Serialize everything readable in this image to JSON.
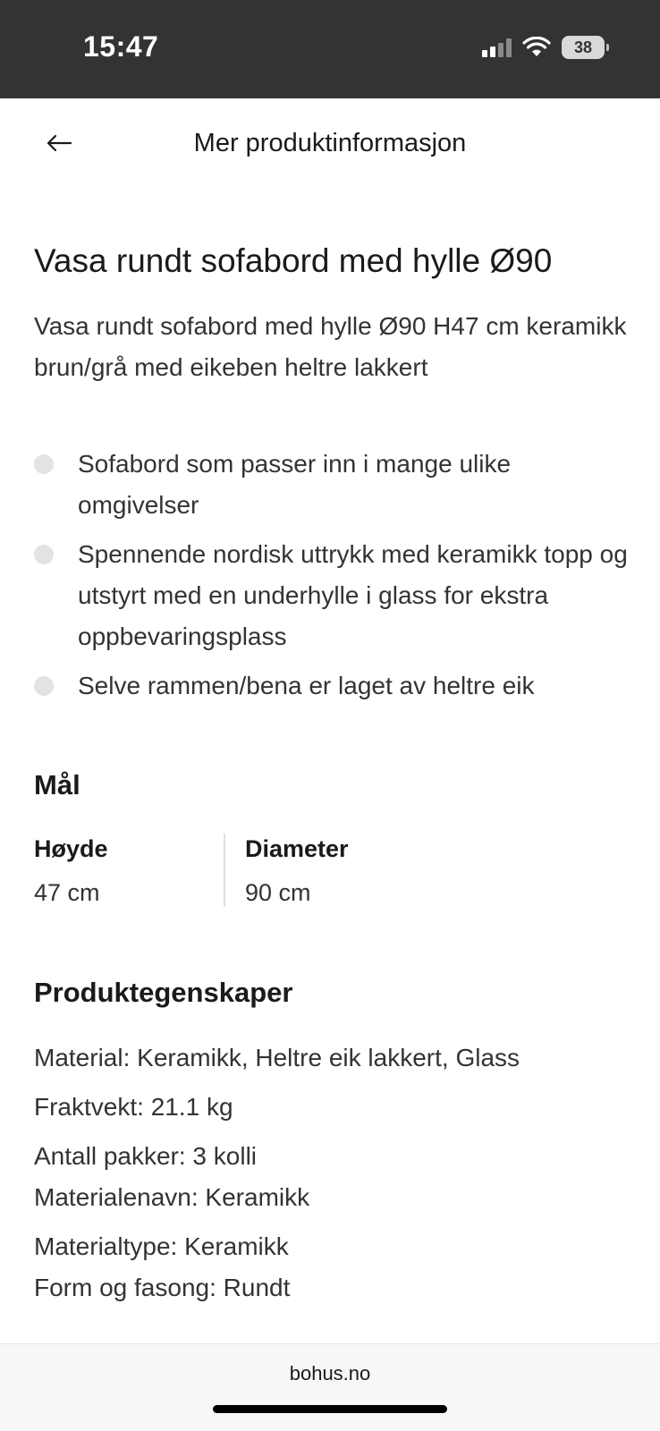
{
  "status_bar": {
    "time": "15:47",
    "battery": "38"
  },
  "header": {
    "title": "Mer produktinformasjon"
  },
  "product": {
    "title": "Vasa rundt sofabord med hylle Ø90",
    "description": "Vasa rundt sofabord med hylle Ø90 H47 cm keramikk brun/grå med eikeben heltre lakkert",
    "features": [
      "Sofabord som passer inn i mange ulike omgivelser",
      "Spennende nordisk uttrykk med keramikk topp og utstyrt med en underhylle i glass for ekstra oppbevaringsplass",
      "Selve rammen/bena er laget av heltre eik"
    ]
  },
  "dimensions": {
    "title": "Mål",
    "items": [
      {
        "label": "Høyde",
        "value": "47 cm"
      },
      {
        "label": "Diameter",
        "value": "90 cm"
      }
    ]
  },
  "properties": {
    "title": "Produktegenskaper",
    "items": [
      "Material: Keramikk, Heltre eik lakkert, Glass",
      "Fraktvekt: 21.1 kg",
      "Antall pakker: 3 kolli",
      "Materialenavn: Keramikk",
      "Materialtype: Keramikk",
      "Form og fasong: Rundt"
    ]
  },
  "browser": {
    "url": "bohus.no"
  },
  "icons": {
    "back": "arrow-left-icon",
    "signal": "cellular-signal-icon",
    "wifi": "wifi-icon",
    "battery": "battery-icon"
  },
  "colors": {
    "status_bar_bg": "#333333",
    "bullet": "#e3e3e3",
    "text": "#1a1a1a"
  }
}
